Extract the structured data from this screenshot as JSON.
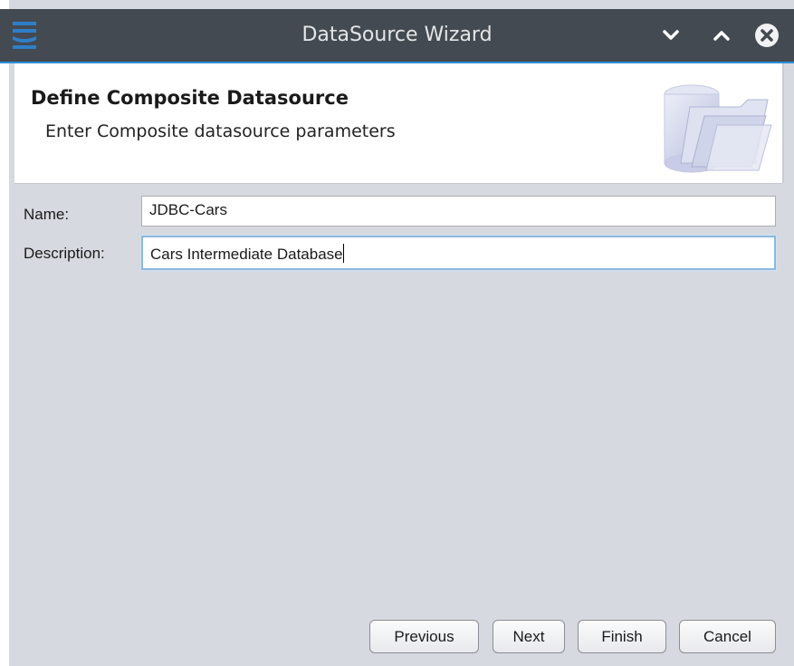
{
  "window": {
    "title": "DataSource Wizard",
    "controls": {
      "minimize_icon": "chevron-down-icon",
      "maximize_icon": "chevron-up-icon",
      "close_icon": "close-icon"
    },
    "accent_color": "#2f8fd6",
    "titlebar_color": "#444a51"
  },
  "banner": {
    "title": "Define Composite Datasource",
    "subtitle": "Enter Composite datasource parameters",
    "icon": "database-folder-icon"
  },
  "form": {
    "name_label": "Name:",
    "name_value": "JDBC-Cars",
    "description_label": "Description:",
    "description_value": "Cars Intermediate Database"
  },
  "buttons": {
    "previous": "Previous",
    "next": "Next",
    "finish": "Finish",
    "cancel": "Cancel"
  }
}
